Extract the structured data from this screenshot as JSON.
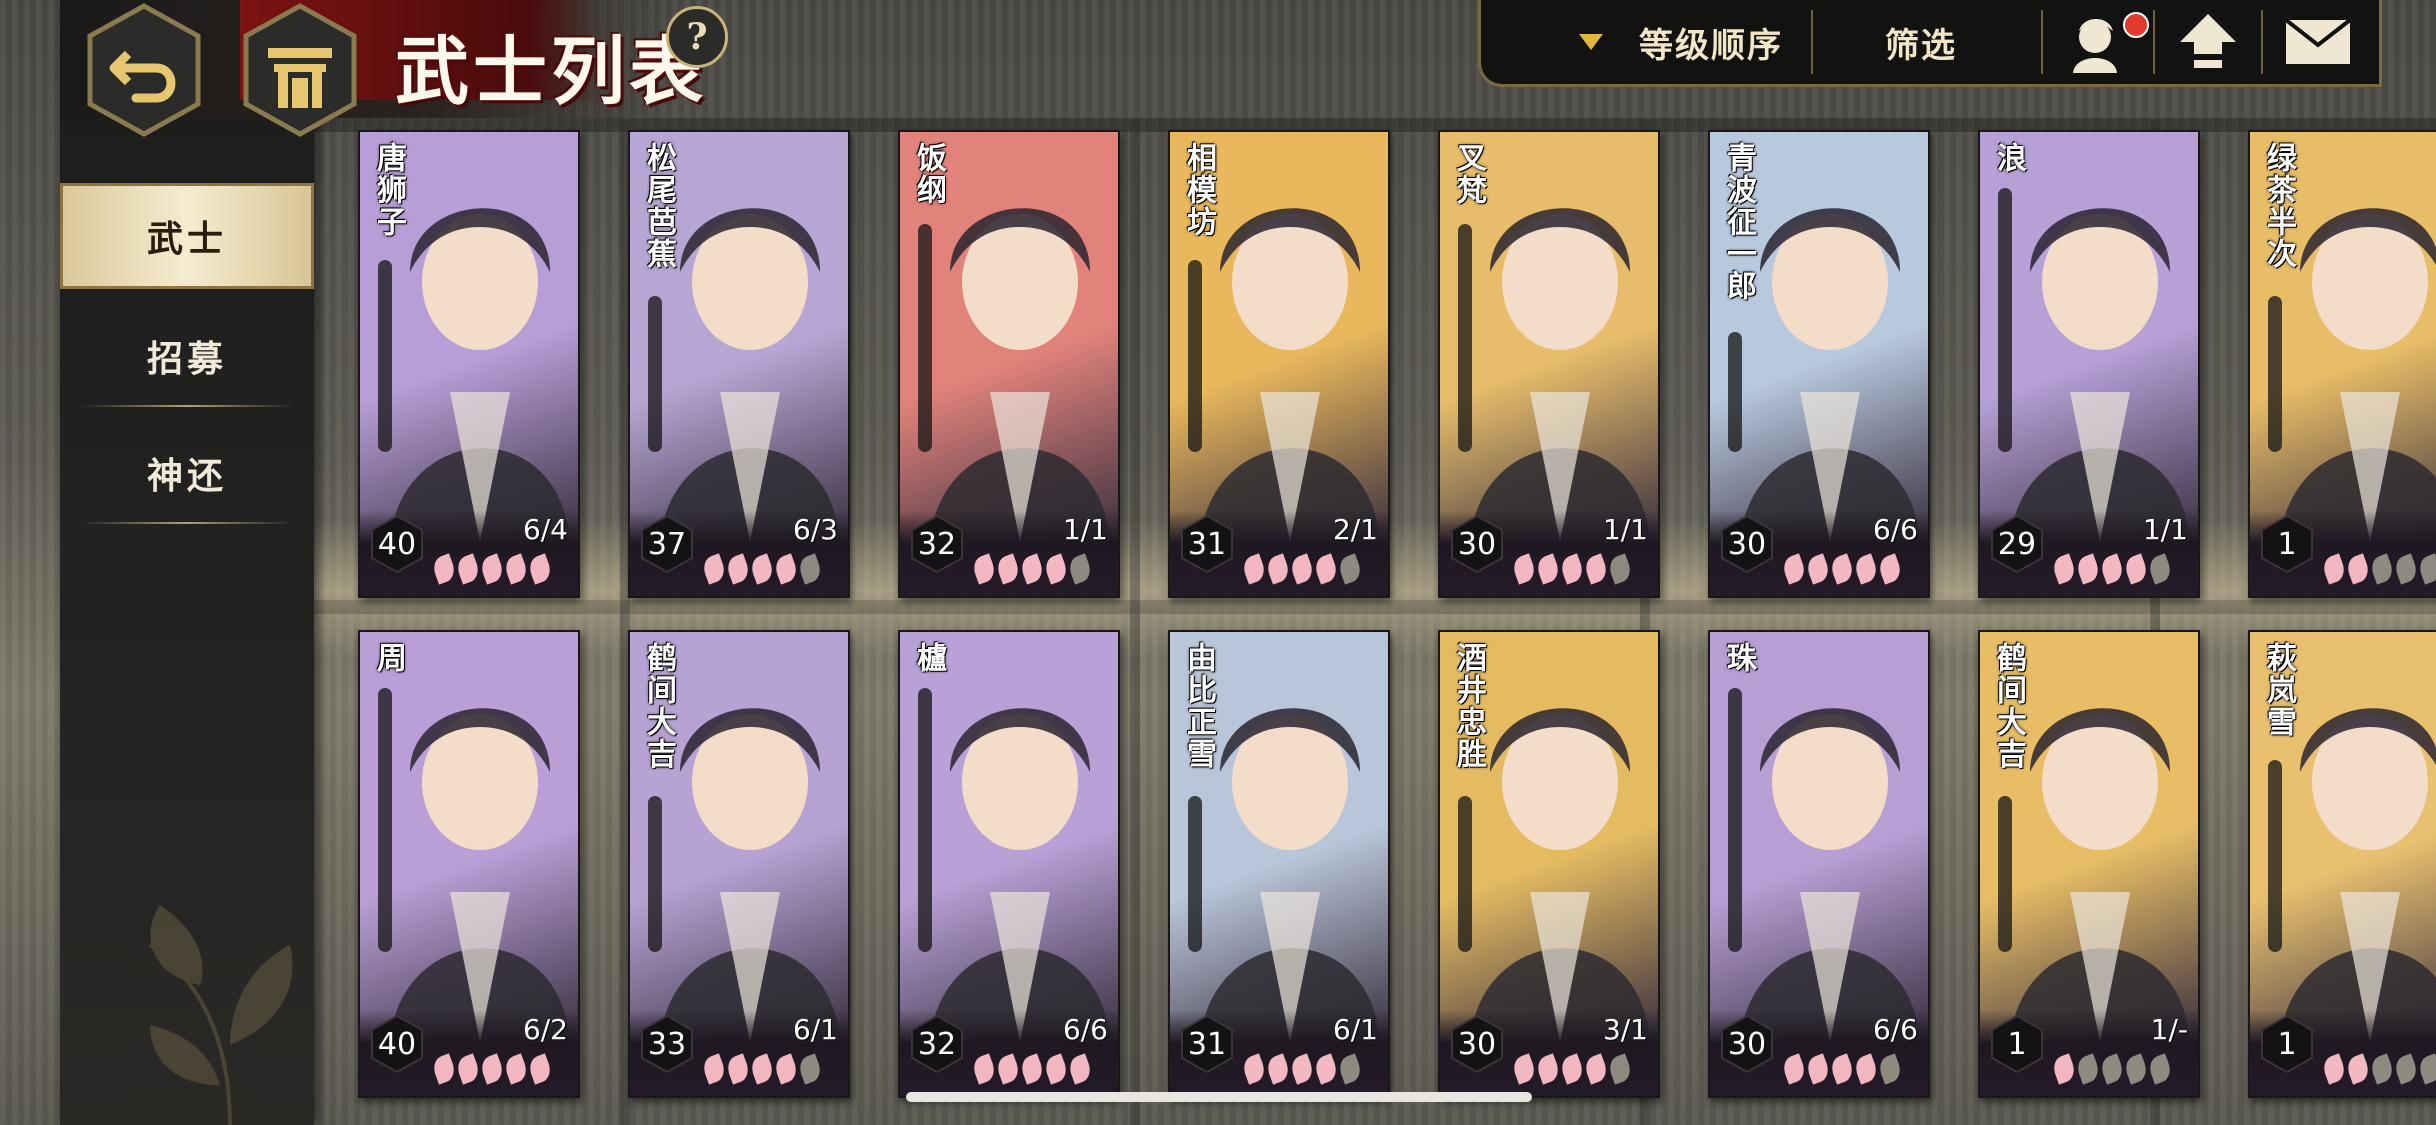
{
  "header": {
    "title": "武士列表",
    "help_label": "?"
  },
  "toolbar": {
    "sort_label": "等级顺序",
    "filter_label": "筛选",
    "icons": [
      "character-icon",
      "home-upgrade-icon",
      "mail-icon"
    ]
  },
  "sidebar": {
    "items": [
      {
        "label": "武士",
        "active": true
      },
      {
        "label": "招募",
        "active": false
      },
      {
        "label": "神还",
        "active": false
      }
    ]
  },
  "cards": [
    {
      "name": "唐狮子",
      "level": "40",
      "progress": "6/4",
      "petals": 5,
      "bg": "#b79ed6"
    },
    {
      "name": "松尾芭蕉",
      "level": "37",
      "progress": "6/3",
      "petals": 4,
      "bg": "#b7a6d4"
    },
    {
      "name": "饭纲",
      "level": "32",
      "progress": "1/1",
      "petals": 4,
      "bg": "#e2837b"
    },
    {
      "name": "相模坊",
      "level": "31",
      "progress": "2/1",
      "petals": 4,
      "bg": "#e9b85c"
    },
    {
      "name": "叉梵",
      "level": "30",
      "progress": "1/1",
      "petals": 4,
      "bg": "#e7bd6b"
    },
    {
      "name": "青波征一郎",
      "level": "30",
      "progress": "6/6",
      "petals": 5,
      "bg": "#b8c9de"
    },
    {
      "name": "浪",
      "level": "29",
      "progress": "1/1",
      "petals": 4,
      "bg": "#b6a0d6"
    },
    {
      "name": "绿茶半次",
      "level": "1",
      "progress": "",
      "petals": 2,
      "bg": "#e8bd67"
    },
    {
      "name": "周",
      "level": "40",
      "progress": "6/2",
      "petals": 5,
      "bg": "#b99fd6"
    },
    {
      "name": "鹤间大吉",
      "level": "33",
      "progress": "6/1",
      "petals": 4,
      "bg": "#b6a2d3"
    },
    {
      "name": "櫨",
      "level": "32",
      "progress": "6/6",
      "petals": 5,
      "bg": "#b8a1d6"
    },
    {
      "name": "由比正雪",
      "level": "31",
      "progress": "6/1",
      "petals": 4,
      "bg": "#b9c6d9"
    },
    {
      "name": "酒井忠胜",
      "level": "30",
      "progress": "3/1",
      "petals": 4,
      "bg": "#e5bb62"
    },
    {
      "name": "珠",
      "level": "30",
      "progress": "6/6",
      "petals": 4,
      "bg": "#b79fd4"
    },
    {
      "name": "鹤间大吉",
      "level": "1",
      "progress": "1/-",
      "petals": 1,
      "bg": "#e7bd66"
    },
    {
      "name": "萩岚雪",
      "level": "1",
      "progress": "",
      "petals": 2,
      "bg": "#e8c070"
    }
  ],
  "colors": {
    "sidebar_active_bg": "#f5ecd0",
    "accent_gold": "#c9b37d",
    "petal_on": "#f2b7c0",
    "petal_off": "#8f8a80",
    "notification": "#e23b2e"
  }
}
